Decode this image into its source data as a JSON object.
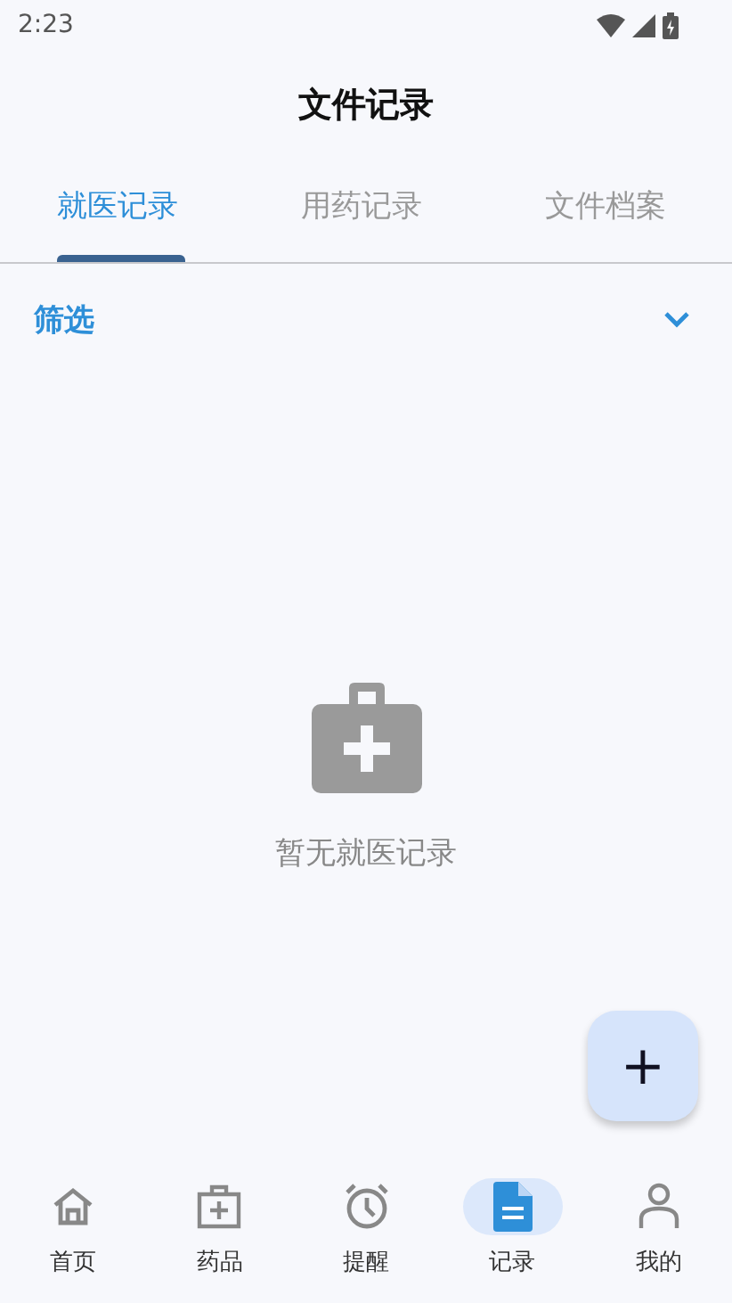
{
  "status_bar": {
    "time": "2:23"
  },
  "title": "文件记录",
  "tabs": [
    {
      "label": "就医记录",
      "selected": true
    },
    {
      "label": "用药记录",
      "selected": false
    },
    {
      "label": "文件档案",
      "selected": false
    }
  ],
  "filter": {
    "label": "筛选",
    "expanded": false
  },
  "empty_state": {
    "message": "暂无就医记录"
  },
  "fab": {
    "label": "+"
  },
  "bottom_nav": [
    {
      "label": "首页",
      "kind": "home",
      "selected": false
    },
    {
      "label": "药品",
      "kind": "medkit",
      "selected": false
    },
    {
      "label": "提醒",
      "kind": "alarm",
      "selected": false
    },
    {
      "label": "记录",
      "kind": "document",
      "selected": true
    },
    {
      "label": "我的",
      "kind": "person",
      "selected": false
    }
  ]
}
